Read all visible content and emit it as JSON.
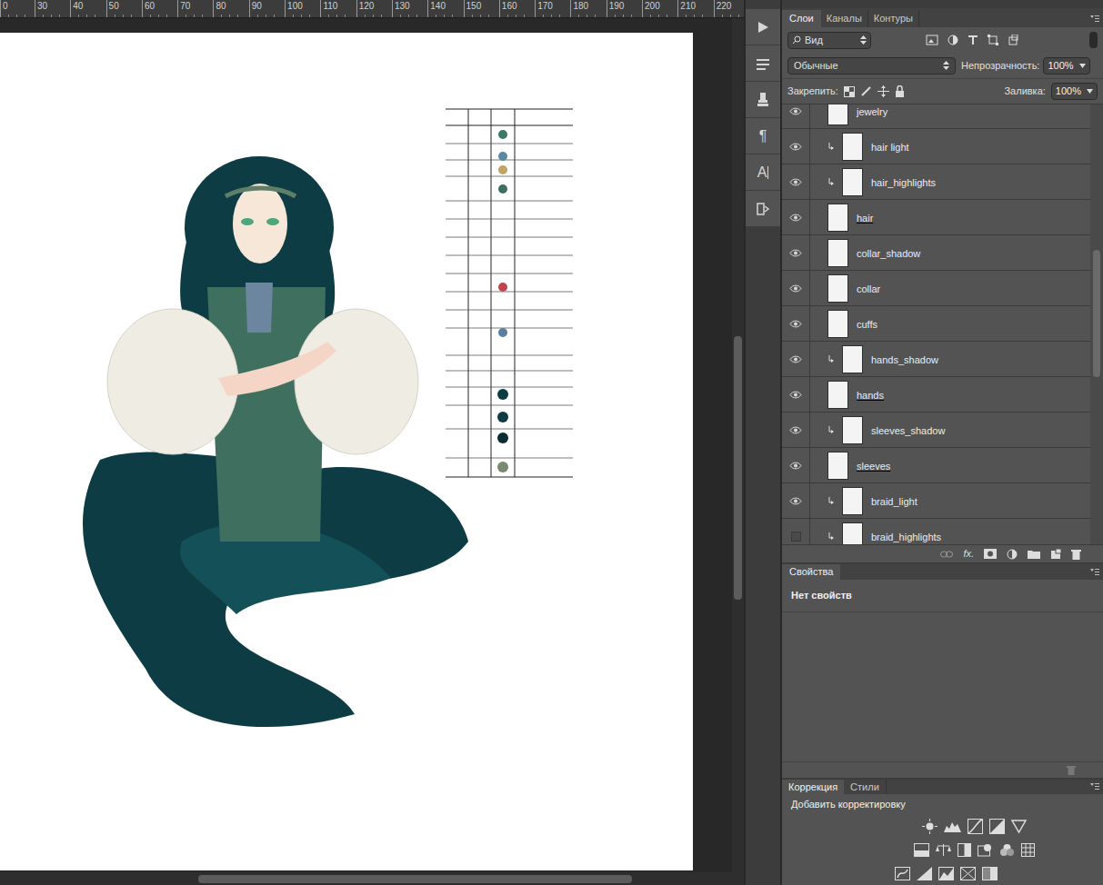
{
  "ruler": [
    "0",
    "30",
    "40",
    "50",
    "60",
    "70",
    "80",
    "90",
    "100",
    "110",
    "120",
    "130",
    "140",
    "150",
    "160",
    "170",
    "180",
    "190",
    "200",
    "210",
    "220"
  ],
  "tool_glyphs": {
    "paragraph": "¶",
    "character": "A"
  },
  "panel_tabs": [
    {
      "label": "Слои",
      "selected": true
    },
    {
      "label": "Каналы",
      "selected": false
    },
    {
      "label": "Контуры",
      "selected": false
    }
  ],
  "filter": {
    "value": "Вид"
  },
  "blend_mode": {
    "value": "Обычные"
  },
  "opacity": {
    "label": "Непрозрачность:",
    "value": "100%"
  },
  "lock": {
    "label": "Закрепить:"
  },
  "fill": {
    "label": "Заливка:",
    "value": "100%"
  },
  "layers": [
    {
      "name": "jewelry",
      "visible": true,
      "clipped": false,
      "clipping_base": false
    },
    {
      "name": "hair light",
      "visible": true,
      "clipped": true,
      "clipping_base": false
    },
    {
      "name": "hair_highlights",
      "visible": true,
      "clipped": true,
      "clipping_base": false
    },
    {
      "name": "hair",
      "visible": true,
      "clipped": false,
      "clipping_base": true
    },
    {
      "name": "collar_shadow",
      "visible": true,
      "clipped": false,
      "clipping_base": false
    },
    {
      "name": "collar",
      "visible": true,
      "clipped": false,
      "clipping_base": false
    },
    {
      "name": "cuffs",
      "visible": true,
      "clipped": false,
      "clipping_base": false
    },
    {
      "name": "hands_shadow",
      "visible": true,
      "clipped": true,
      "clipping_base": false
    },
    {
      "name": "hands",
      "visible": true,
      "clipped": false,
      "clipping_base": true
    },
    {
      "name": "sleeves_shadow",
      "visible": true,
      "clipped": true,
      "clipping_base": false
    },
    {
      "name": "sleeves",
      "visible": true,
      "clipped": false,
      "clipping_base": true
    },
    {
      "name": "braid_light",
      "visible": true,
      "clipped": true,
      "clipping_base": false
    },
    {
      "name": "braid_highlights",
      "visible": false,
      "clipped": true,
      "clipping_base": false
    }
  ],
  "layers_footer": {
    "fx": "fx."
  },
  "properties": {
    "tab": "Свойства",
    "message": "Нет свойств"
  },
  "adjustments": {
    "tabs": [
      {
        "label": "Коррекция",
        "selected": true
      },
      {
        "label": "Стили",
        "selected": false
      }
    ],
    "title": "Добавить корректировку"
  }
}
